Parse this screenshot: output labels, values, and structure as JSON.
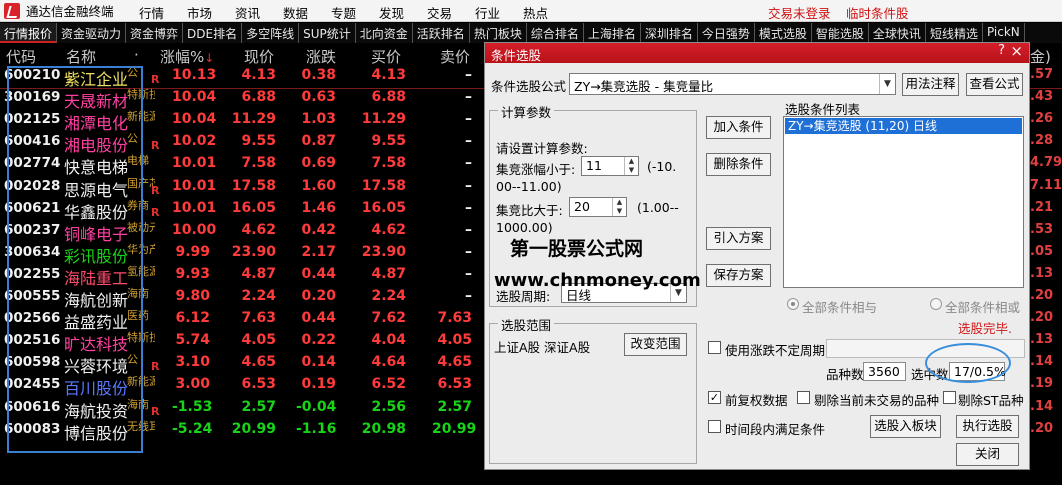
{
  "menubar": {
    "app_title": "通达信金融终端",
    "items": [
      "行情",
      "市场",
      "资讯",
      "数据",
      "专题",
      "发现",
      "交易",
      "行业",
      "热点"
    ],
    "login_status": "交易未登录",
    "temp_condition": "临时条件股"
  },
  "tabs": [
    "行情报价",
    "资金驱动力",
    "资金博弈",
    "DDE排名",
    "多空阵线",
    "SUP统计",
    "北向资金",
    "活跃排名",
    "热门板块",
    "综合排名",
    "上海排名",
    "深圳排名",
    "今日强势",
    "模式选股",
    "智能选股",
    "全球快讯",
    "短线精选",
    "PickN"
  ],
  "table": {
    "headers": {
      "code": "代码",
      "name": "名称",
      "dot": "·",
      "chg": "涨幅%",
      "price": "现价",
      "diff": "涨跌",
      "bid": "买价",
      "ask": "卖价",
      "far": "金)"
    },
    "rows": [
      {
        "code": "600210",
        "name": "紫江企业",
        "tag": "公",
        "flag": "R",
        "chg": "10.13",
        "price": "4.13",
        "diff": "0.38",
        "bid": "4.13",
        "ask": "–",
        "right": ".57",
        "color": "yellow"
      },
      {
        "code": "300169",
        "name": "天晟新材",
        "tag": "特斯拉",
        "flag": "",
        "chg": "10.04",
        "price": "6.88",
        "diff": "0.63",
        "bid": "6.88",
        "ask": "–",
        "right": ".43",
        "color": "magenta"
      },
      {
        "code": "002125",
        "name": "湘潭电化",
        "tag": "新能源汽",
        "flag": "",
        "chg": "10.04",
        "price": "11.29",
        "diff": "1.03",
        "bid": "11.29",
        "ask": "–",
        "right": ".26",
        "color": "magenta"
      },
      {
        "code": "600416",
        "name": "湘电股份",
        "tag": "公",
        "flag": "R",
        "chg": "10.02",
        "price": "9.55",
        "diff": "0.87",
        "bid": "9.55",
        "ask": "–",
        "right": ".28",
        "color": "magenta"
      },
      {
        "code": "002774",
        "name": "快意电梯",
        "tag": "电梯",
        "flag": "",
        "chg": "10.01",
        "price": "7.58",
        "diff": "0.69",
        "bid": "7.58",
        "ask": "–",
        "right": "4.79",
        "color": "white"
      },
      {
        "code": "002028",
        "name": "思源电气",
        "tag": "国产芯片",
        "flag": "R",
        "chg": "10.01",
        "price": "17.58",
        "diff": "1.60",
        "bid": "17.58",
        "ask": "–",
        "right": "7.11",
        "color": "white"
      },
      {
        "code": "600621",
        "name": "华鑫股份",
        "tag": "券商",
        "flag": "R",
        "chg": "10.01",
        "price": "16.05",
        "diff": "1.46",
        "bid": "16.05",
        "ask": "–",
        "right": ".21",
        "color": "white"
      },
      {
        "code": "600237",
        "name": "铜峰电子",
        "tag": "被动元件",
        "flag": "",
        "chg": "10.00",
        "price": "4.62",
        "diff": "0.42",
        "bid": "4.62",
        "ask": "–",
        "right": ".53",
        "color": "magenta"
      },
      {
        "code": "300634",
        "name": "彩讯股份",
        "tag": "华为产业",
        "flag": "",
        "chg": "9.99",
        "price": "23.90",
        "diff": "2.17",
        "bid": "23.90",
        "ask": "–",
        "right": ".05",
        "color": "green"
      },
      {
        "code": "002255",
        "name": "海陆重工",
        "tag": "氢能源Ga",
        "flag": "",
        "chg": "9.93",
        "price": "4.87",
        "diff": "0.44",
        "bid": "4.87",
        "ask": "–",
        "right": ".13",
        "color": "namered"
      },
      {
        "code": "600555",
        "name": "海航创新",
        "tag": "海南",
        "flag": "",
        "chg": "9.80",
        "price": "2.24",
        "diff": "0.20",
        "bid": "2.24",
        "ask": "–",
        "right": ".20",
        "color": "white"
      },
      {
        "code": "002566",
        "name": "益盛药业",
        "tag": "医药",
        "flag": "",
        "chg": "6.12",
        "price": "7.63",
        "diff": "0.44",
        "bid": "7.62",
        "ask": "7.63",
        "right": ".20",
        "color": "white"
      },
      {
        "code": "002516",
        "name": "旷达科技",
        "tag": "特斯拉",
        "flag": "",
        "chg": "5.74",
        "price": "4.05",
        "diff": "0.22",
        "bid": "4.04",
        "ask": "4.05",
        "right": ".13",
        "color": "magenta"
      },
      {
        "code": "600598",
        "name": "兴蓉环境",
        "tag": "公",
        "flag": "R",
        "chg": "3.10",
        "price": "4.65",
        "diff": "0.14",
        "bid": "4.64",
        "ask": "4.65",
        "right": ".14",
        "color": "white"
      },
      {
        "code": "002455",
        "name": "百川股份",
        "tag": "新能源汽",
        "flag": "",
        "chg": "3.00",
        "price": "6.53",
        "diff": "0.19",
        "bid": "6.52",
        "ask": "6.53",
        "right": ".19",
        "color": "blue"
      },
      {
        "code": "600616",
        "name": "海航投资",
        "tag": "海南",
        "flag": "R",
        "chg": "-1.53",
        "price": "2.57",
        "diff": "-0.04",
        "bid": "2.56",
        "ask": "2.57",
        "right": ".14",
        "color": "white"
      },
      {
        "code": "600083",
        "name": "博信股份",
        "tag": "无线耳机",
        "flag": "",
        "chg": "-5.24",
        "price": "20.99",
        "diff": "-1.16",
        "bid": "20.98",
        "ask": "20.99",
        "right": ".20",
        "color": "white"
      }
    ]
  },
  "dialog": {
    "title": "条件选股",
    "help": "?",
    "close": "×",
    "formula_label": "条件选股公式",
    "formula_value": "ZY→集竞选股 - 集竞量比",
    "usage_btn": "用法注释",
    "view_formula_btn": "查看公式",
    "calc_params_title": "计算参数",
    "calc_params_prompt": "请设置计算参数:",
    "param1_label": "集竞涨幅小于:",
    "param1_value": "11",
    "param1_range_a": "(-10.",
    "param1_range_b": "00--11.00)",
    "param2_label": "集竞比大于:",
    "param2_value": "20",
    "param2_range_a": "(1.00--",
    "param2_range_b": "1000.00)",
    "period_label": "选股周期:",
    "period_value": "日线",
    "add_btn": "加入条件",
    "delete_btn": "删除条件",
    "import_btn": "引入方案",
    "save_btn": "保存方案",
    "cond_list_title": "选股条件列表",
    "cond_list_item": "ZY→集竞选股 (11,20) 日线",
    "radio_and": "全部条件相与",
    "radio_or": "全部条件相或",
    "done_text": "选股完毕.",
    "scope_title": "选股范围",
    "scope_value": "上证A股 深证A股",
    "change_scope_btn": "改变范围",
    "use_period_label": "使用涨跌不定周期",
    "count_label": "品种数",
    "count_value": "3560",
    "selected_label": "选中数",
    "selected_value": "17/0.5%",
    "pre_adjust_label": "前复权数据",
    "exclude_untraded_label": "剔除当前未交易的品种",
    "exclude_st_label": "剔除ST品种",
    "time_period_label": "时间段内满足条件",
    "add_to_block_btn": "选股入板块",
    "execute_btn": "执行选股",
    "close_btn": "关闭"
  },
  "watermark": {
    "line1": "第一股票公式网",
    "line2": "www.chnmoney.com"
  },
  "colors": {
    "accent": "#d41f2a",
    "highlight": "#3a7fd0"
  }
}
